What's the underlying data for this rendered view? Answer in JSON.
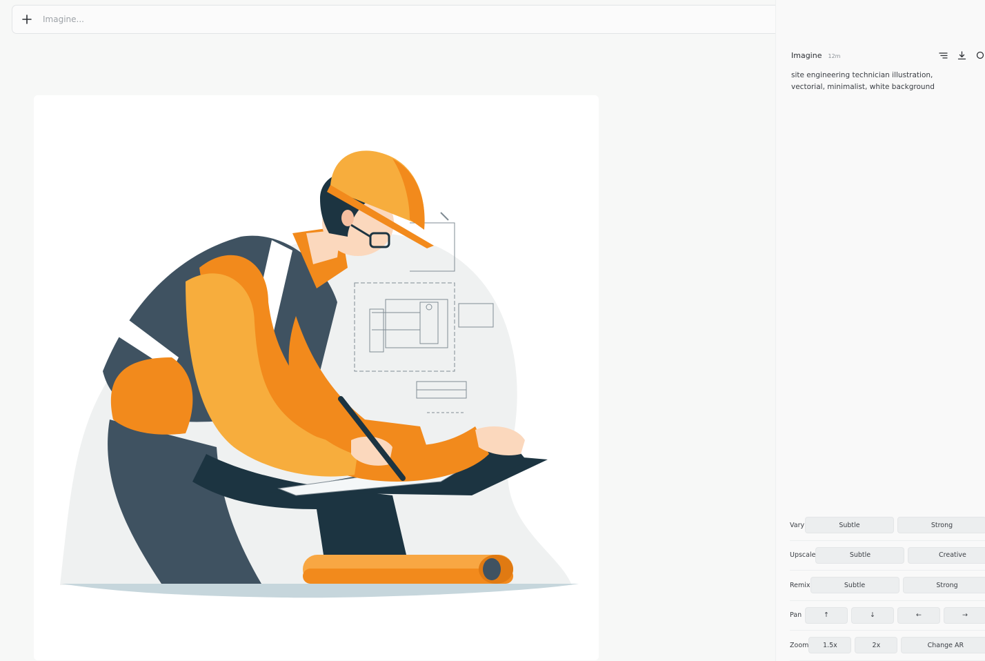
{
  "prompt_bar": {
    "placeholder": "Imagine...",
    "plus_icon": "plus-icon",
    "settings_icon": "sliders-icon"
  },
  "close_icon": "close-icon",
  "job": {
    "type": "Imagine",
    "age": "12m",
    "prompt": "site engineering technician illustration, vectorial, minimalist, white background",
    "icons": [
      "lines-icon",
      "download-icon",
      "search-icon"
    ]
  },
  "actions": {
    "vary": {
      "label": "Vary",
      "buttons": [
        "Subtle",
        "Strong"
      ]
    },
    "upscale": {
      "label": "Upscale",
      "buttons": [
        "Subtle",
        "Creative"
      ]
    },
    "remix": {
      "label": "Remix",
      "buttons": [
        "Subtle",
        "Strong"
      ]
    },
    "pan": {
      "label": "Pan",
      "buttons": [
        "↑",
        "↓",
        "←",
        "→"
      ]
    },
    "zoom": {
      "label": "Zoom",
      "buttons": [
        "1.5x",
        "2x",
        "Change AR"
      ]
    }
  },
  "colors": {
    "orange": "#f28a1c",
    "helmet": "#f7ad3d",
    "navy": "#3f5261",
    "dark": "#1c3441",
    "ground": "#c6d6dc"
  }
}
